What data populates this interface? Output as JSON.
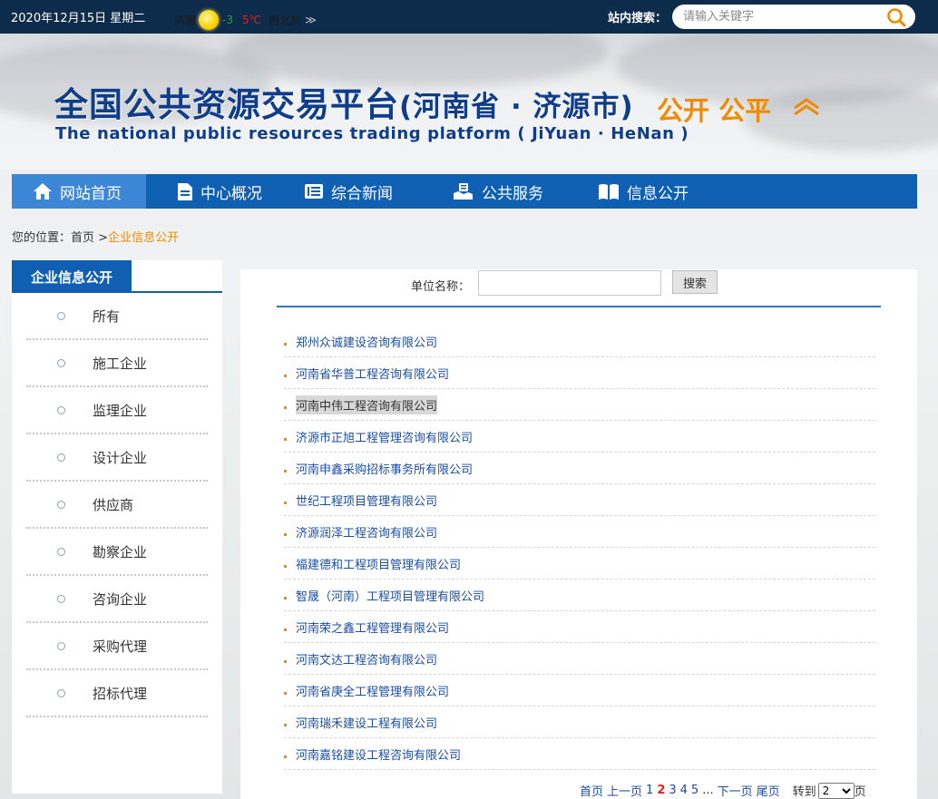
{
  "topbar": {
    "date": "2020年12月15日 星期二",
    "weather": {
      "city": "济源",
      "low": "-3",
      "tilde": "~",
      "high": "5℃",
      "wind": "西北风",
      "more": "≫"
    },
    "search_label": "站内搜索：",
    "search_placeholder": "请输入关键字"
  },
  "banner": {
    "title_cn": "全国公共资源交易平台",
    "title_region": "(河南省 · 济源市)",
    "slogan": "公开 公平",
    "title_en": "The national public resources trading platform ( JiYuan · HeNan )"
  },
  "nav": {
    "items": [
      {
        "label": "网站首页",
        "icon": "home-icon"
      },
      {
        "label": "中心概况",
        "icon": "document-icon"
      },
      {
        "label": "综合新闻",
        "icon": "news-icon"
      },
      {
        "label": "公共服务",
        "icon": "service-icon"
      },
      {
        "label": "信息公开",
        "icon": "book-icon"
      }
    ]
  },
  "breadcrumb": {
    "prefix": "您的位置：",
    "home": "首页",
    "sep": " >",
    "current": "企业信息公开"
  },
  "sidebar": {
    "title": "企业信息公开",
    "items": [
      "所有",
      "施工企业",
      "监理企业",
      "设计企业",
      "供应商",
      "勘察企业",
      "咨询企业",
      "采购代理",
      "招标代理"
    ]
  },
  "filter": {
    "label": "单位名称：",
    "input_value": "",
    "button": "搜索"
  },
  "companies": [
    "郑州众诚建设咨询有限公司",
    "河南省华普工程咨询有限公司",
    "河南中伟工程咨询有限公司",
    "济源市正旭工程管理咨询有限公司",
    "河南申鑫采购招标事务所有限公司",
    "世纪工程项目管理有限公司",
    "济源润泽工程咨询有限公司",
    "福建德和工程项目管理有限公司",
    "智晟（河南）工程项目管理有限公司",
    "河南荣之鑫工程管理有限公司",
    "河南文达工程咨询有限公司",
    "河南省庚全工程管理有限公司",
    "河南瑞禾建设工程有限公司",
    "河南嘉铭建设工程咨询有限公司"
  ],
  "pager": {
    "first": "首页",
    "prev": "上一页",
    "pages": [
      "1",
      "2",
      "3",
      "4",
      "5"
    ],
    "current": "2",
    "ellipsis": "...",
    "next": "下一页",
    "last": "尾页",
    "goto": "转到",
    "goto_value": "2",
    "page_unit": "页"
  },
  "colors": {
    "nav_blue": "#0f5fb3",
    "accent_orange": "#f08a00",
    "link_blue": "#1a4ea3",
    "topbar": "#0d2b4a"
  }
}
